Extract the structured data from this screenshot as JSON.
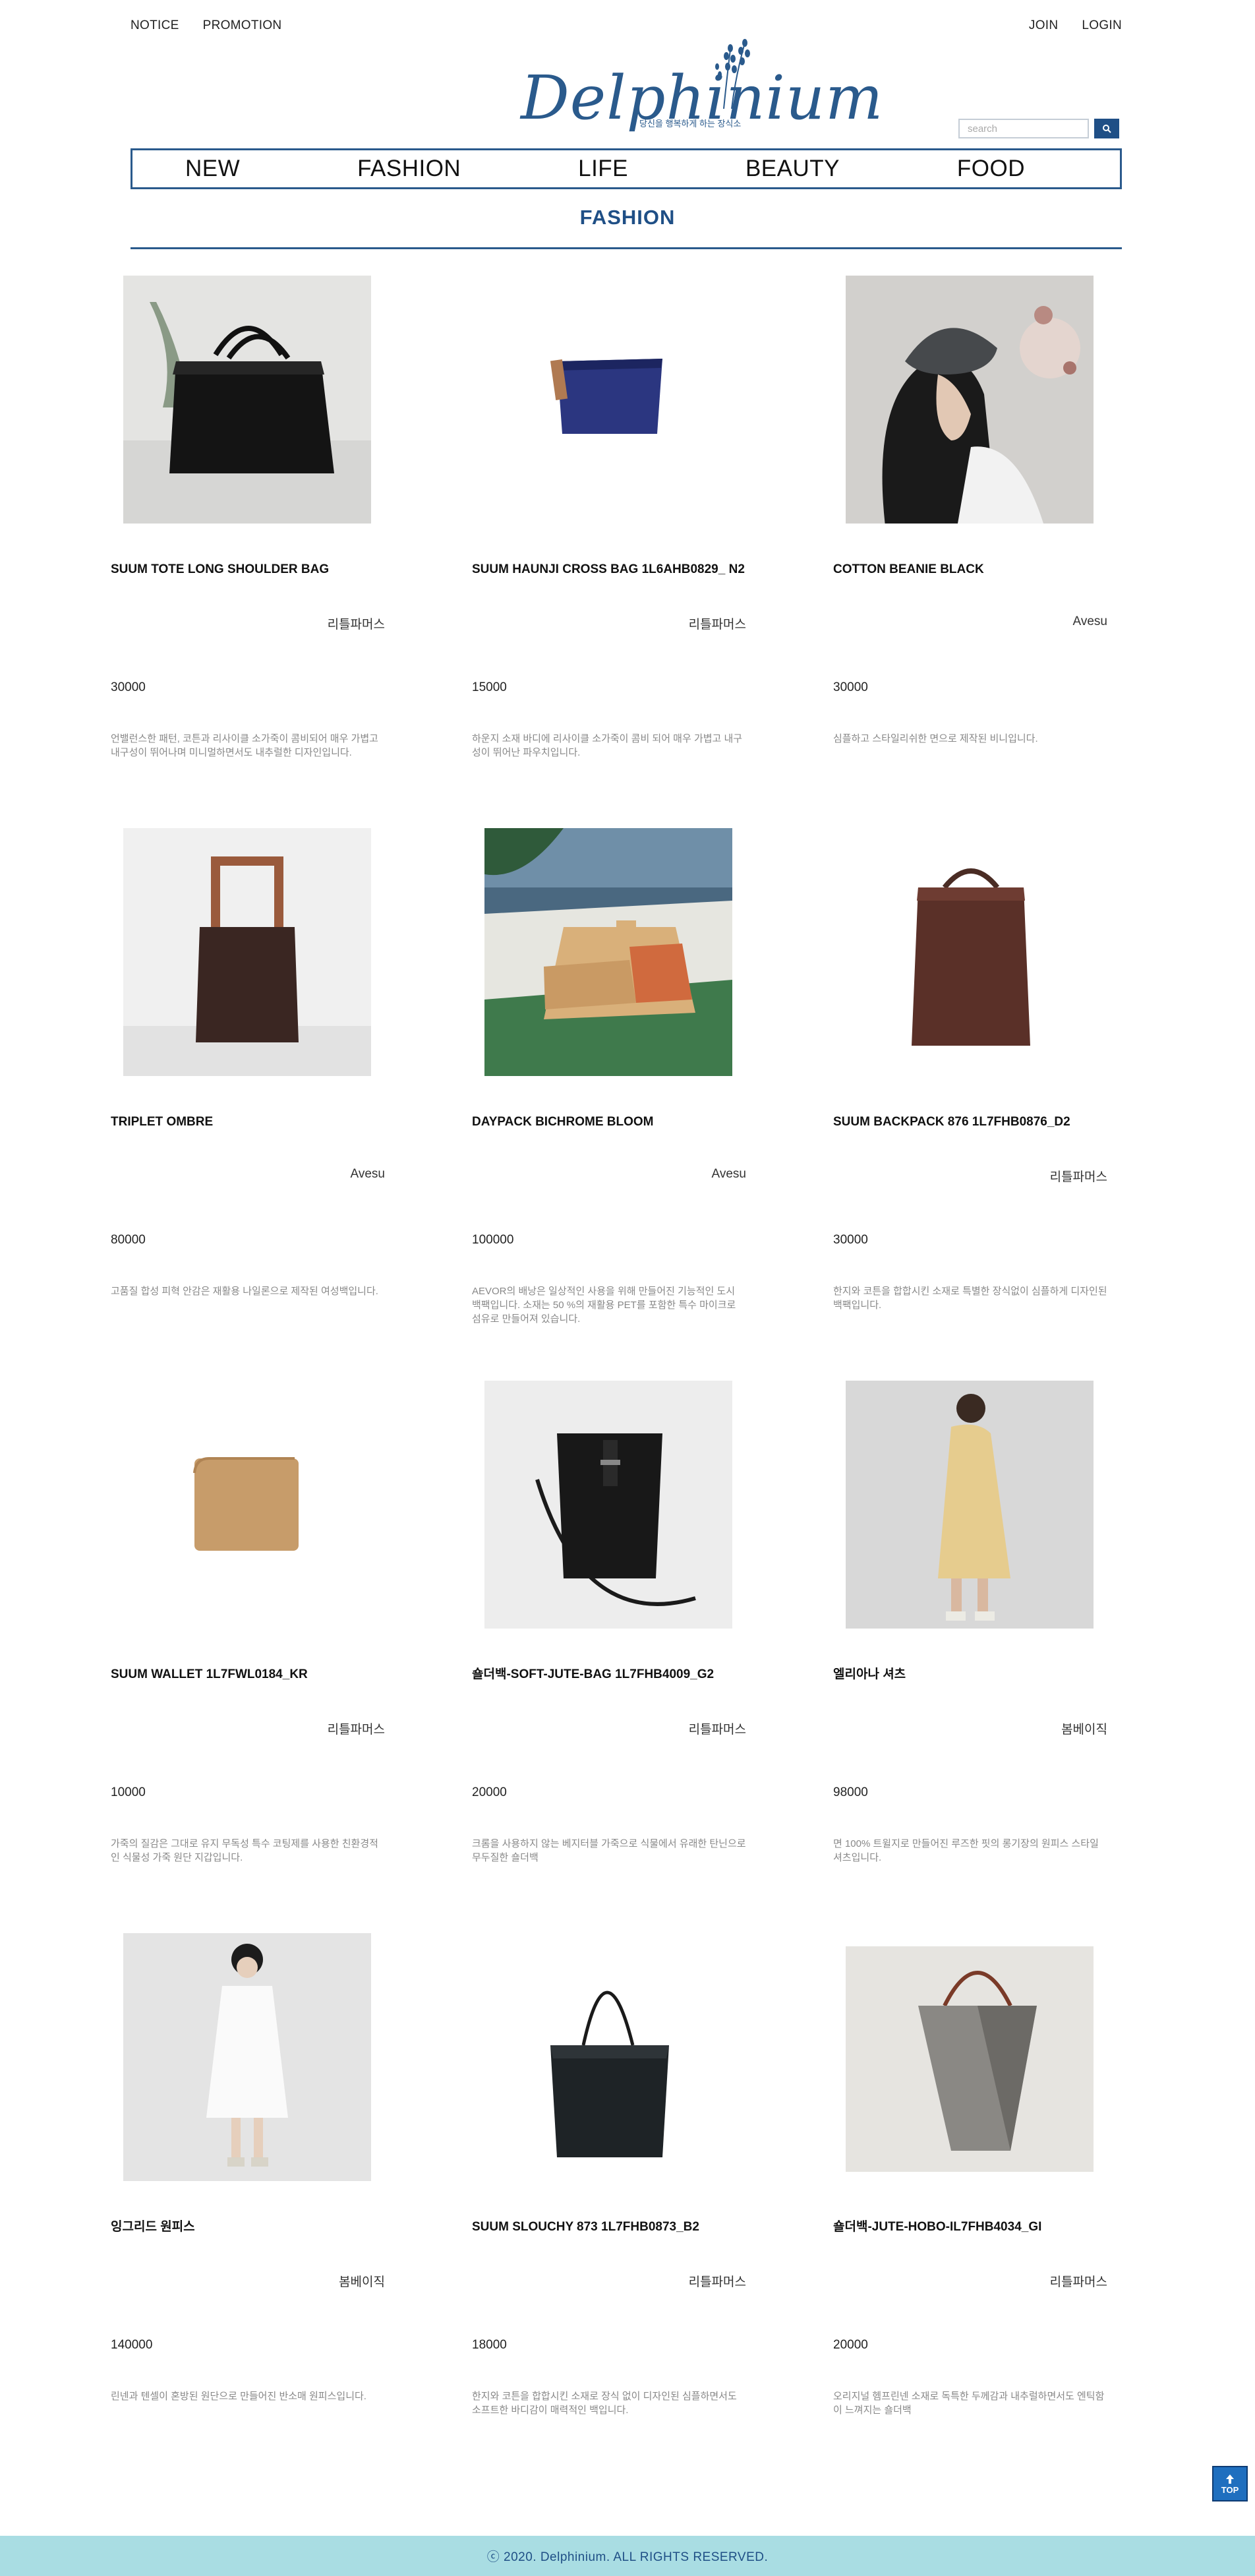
{
  "top_nav": {
    "left": [
      "NOTICE",
      "PROMOTION"
    ],
    "right": [
      "JOIN",
      "LOGIN"
    ]
  },
  "logo": {
    "name": "Delphinium",
    "tagline": "당신을 행복하게 하는 장식소"
  },
  "search": {
    "placeholder": "search"
  },
  "gnb": [
    "NEW",
    "FASHION",
    "LIFE",
    "BEAUTY",
    "FOOD"
  ],
  "section_title": "FASHION",
  "products": [
    {
      "name": "SUUM TOTE LONG SHOULDER BAG",
      "brand": "리틀파머스",
      "price": "30000",
      "desc": "언밸런스한 패턴, 코튼과 리사이클 소가죽이 콤비되어 매우 가볍고 내구성이 뛰어나며 미니멀하면서도 내추럴한 디자인입니다.",
      "image": "black-tote-bag"
    },
    {
      "name": "SUUM HAUNJI CROSS BAG 1L6AHB0829_ N2",
      "brand": "리틀파머스",
      "price": "15000",
      "desc": "하운지 소재 바디에 리사이클 소가죽이 콤비 되어 매우 가볍고 내구성이 뛰어난 파우치입니다.",
      "image": "navy-pouch"
    },
    {
      "name": "COTTON BEANIE BLACK",
      "brand": "Avesu",
      "price": "30000",
      "desc": "심플하고 스타일리쉬한 면으로 제작된 비니입니다.",
      "image": "beanie-model"
    },
    {
      "name": "TRIPLET OMBRE",
      "brand": "Avesu",
      "price": "80000",
      "desc": "고품질 합성 피혁 안감은 재활용 나일론으로 제작된 여성백입니다.",
      "image": "wood-handle-bag"
    },
    {
      "name": "DAYPACK BICHROME BLOOM",
      "brand": "Avesu",
      "price": "100000",
      "desc": "AEVOR의 배낭은 일상적인 사용을 위해 만들어진 기능적인 도시 백팩입니다. 소재는 50 %의 재활용 PET를 포함한 특수 마이크로 섬유로 만들어져 있습니다.",
      "image": "bichrome-bag"
    },
    {
      "name": "SUUM BACKPACK 876 1L7FHB0876_D2",
      "brand": "리틀파머스",
      "price": "30000",
      "desc": "한지와 코튼을 합합시킨 소재로 특별한 장식없이 심플하게 디자인된 백팩입니다.",
      "image": "brown-backpack"
    },
    {
      "name": "SUUM WALLET 1L7FWL0184_KR",
      "brand": "리틀파머스",
      "price": "10000",
      "desc": "가죽의 질감은 그대로 유지 무독성 특수 코팅제를 사용한 친환경적인 식물성 가죽 원단 지갑입니다.",
      "image": "tan-wallet"
    },
    {
      "name": "숄더백-SOFT-JUTE-BAG 1L7FHB4009_G2",
      "brand": "리틀파머스",
      "price": "20000",
      "desc": "크롬을 사용하지 않는 베지터블 가죽으로 식물에서 유래한 탄닌으로 무두질한 숄더백",
      "image": "black-bucket-bag"
    },
    {
      "name": "엘리아나 셔츠",
      "brand": "봄베이직",
      "price": "98000",
      "desc": "면 100% 트윌지로 만들어진 루즈한 핏의 롱기장의 원피스 스타일 셔츠입니다.",
      "image": "beige-shirt-model"
    },
    {
      "name": "잉그리드 원피스",
      "brand": "봄베이직",
      "price": "140000",
      "desc": "린넨과 텐셀이 혼방된 원단으로 만들어진 반소매 원피스입니다.",
      "image": "white-dress-model"
    },
    {
      "name": "SUUM SLOUCHY 873 1L7FHB0873_B2",
      "brand": "리틀파머스",
      "price": "18000",
      "desc": "한지와 코튼을 합합시킨 소재로 장식 없이 디자인된 심플하면서도 소프트한 바디감이 매력적인 백입니다.",
      "image": "black-slouchy-bag"
    },
    {
      "name": "숄더백-JUTE-HOBO-IL7FHB4034_GI",
      "brand": "리틀파머스",
      "price": "20000",
      "desc": "오리지널 헴프린넨 소재로 독특한 두께감과 내추럴하면서도 엔틱함이 느껴지는 숄더백",
      "image": "gray-hobo-bag"
    }
  ],
  "top_button": "TOP",
  "footer": "ⓒ 2020. Delphinium. ALL RIGHTS RESERVED."
}
